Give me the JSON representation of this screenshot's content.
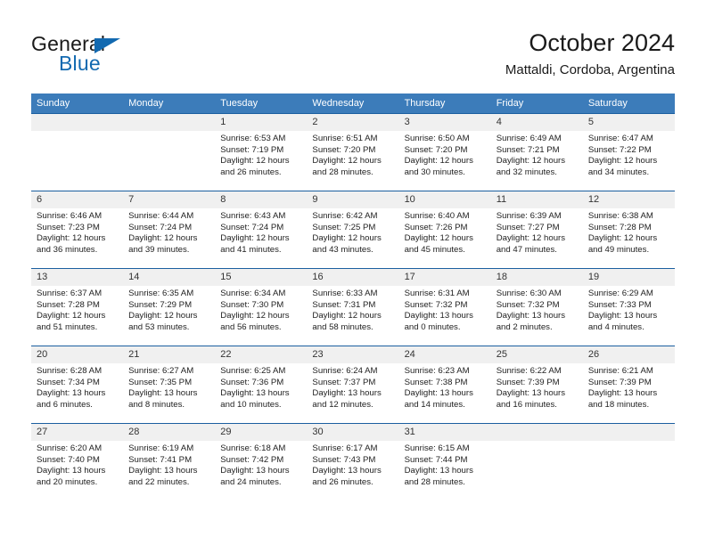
{
  "brand": {
    "name_dark": "General",
    "name_blue": "Blue",
    "accent_color": "#1269b0"
  },
  "header": {
    "title": "October 2024",
    "subtitle": "Mattaldi, Cordoba, Argentina"
  },
  "calendar": {
    "header_bg": "#3c7cba",
    "row_rule_color": "#1b5fa0",
    "daynum_bg": "#f0f0f0",
    "weekday_labels": [
      "Sunday",
      "Monday",
      "Tuesday",
      "Wednesday",
      "Thursday",
      "Friday",
      "Saturday"
    ],
    "weeks": [
      [
        {
          "day": "",
          "sunrise": "",
          "sunset": "",
          "daylight_line1": "",
          "daylight_line2": ""
        },
        {
          "day": "",
          "sunrise": "",
          "sunset": "",
          "daylight_line1": "",
          "daylight_line2": ""
        },
        {
          "day": "1",
          "sunrise": "Sunrise: 6:53 AM",
          "sunset": "Sunset: 7:19 PM",
          "daylight_line1": "Daylight: 12 hours",
          "daylight_line2": "and 26 minutes."
        },
        {
          "day": "2",
          "sunrise": "Sunrise: 6:51 AM",
          "sunset": "Sunset: 7:20 PM",
          "daylight_line1": "Daylight: 12 hours",
          "daylight_line2": "and 28 minutes."
        },
        {
          "day": "3",
          "sunrise": "Sunrise: 6:50 AM",
          "sunset": "Sunset: 7:20 PM",
          "daylight_line1": "Daylight: 12 hours",
          "daylight_line2": "and 30 minutes."
        },
        {
          "day": "4",
          "sunrise": "Sunrise: 6:49 AM",
          "sunset": "Sunset: 7:21 PM",
          "daylight_line1": "Daylight: 12 hours",
          "daylight_line2": "and 32 minutes."
        },
        {
          "day": "5",
          "sunrise": "Sunrise: 6:47 AM",
          "sunset": "Sunset: 7:22 PM",
          "daylight_line1": "Daylight: 12 hours",
          "daylight_line2": "and 34 minutes."
        }
      ],
      [
        {
          "day": "6",
          "sunrise": "Sunrise: 6:46 AM",
          "sunset": "Sunset: 7:23 PM",
          "daylight_line1": "Daylight: 12 hours",
          "daylight_line2": "and 36 minutes."
        },
        {
          "day": "7",
          "sunrise": "Sunrise: 6:44 AM",
          "sunset": "Sunset: 7:24 PM",
          "daylight_line1": "Daylight: 12 hours",
          "daylight_line2": "and 39 minutes."
        },
        {
          "day": "8",
          "sunrise": "Sunrise: 6:43 AM",
          "sunset": "Sunset: 7:24 PM",
          "daylight_line1": "Daylight: 12 hours",
          "daylight_line2": "and 41 minutes."
        },
        {
          "day": "9",
          "sunrise": "Sunrise: 6:42 AM",
          "sunset": "Sunset: 7:25 PM",
          "daylight_line1": "Daylight: 12 hours",
          "daylight_line2": "and 43 minutes."
        },
        {
          "day": "10",
          "sunrise": "Sunrise: 6:40 AM",
          "sunset": "Sunset: 7:26 PM",
          "daylight_line1": "Daylight: 12 hours",
          "daylight_line2": "and 45 minutes."
        },
        {
          "day": "11",
          "sunrise": "Sunrise: 6:39 AM",
          "sunset": "Sunset: 7:27 PM",
          "daylight_line1": "Daylight: 12 hours",
          "daylight_line2": "and 47 minutes."
        },
        {
          "day": "12",
          "sunrise": "Sunrise: 6:38 AM",
          "sunset": "Sunset: 7:28 PM",
          "daylight_line1": "Daylight: 12 hours",
          "daylight_line2": "and 49 minutes."
        }
      ],
      [
        {
          "day": "13",
          "sunrise": "Sunrise: 6:37 AM",
          "sunset": "Sunset: 7:28 PM",
          "daylight_line1": "Daylight: 12 hours",
          "daylight_line2": "and 51 minutes."
        },
        {
          "day": "14",
          "sunrise": "Sunrise: 6:35 AM",
          "sunset": "Sunset: 7:29 PM",
          "daylight_line1": "Daylight: 12 hours",
          "daylight_line2": "and 53 minutes."
        },
        {
          "day": "15",
          "sunrise": "Sunrise: 6:34 AM",
          "sunset": "Sunset: 7:30 PM",
          "daylight_line1": "Daylight: 12 hours",
          "daylight_line2": "and 56 minutes."
        },
        {
          "day": "16",
          "sunrise": "Sunrise: 6:33 AM",
          "sunset": "Sunset: 7:31 PM",
          "daylight_line1": "Daylight: 12 hours",
          "daylight_line2": "and 58 minutes."
        },
        {
          "day": "17",
          "sunrise": "Sunrise: 6:31 AM",
          "sunset": "Sunset: 7:32 PM",
          "daylight_line1": "Daylight: 13 hours",
          "daylight_line2": "and 0 minutes."
        },
        {
          "day": "18",
          "sunrise": "Sunrise: 6:30 AM",
          "sunset": "Sunset: 7:32 PM",
          "daylight_line1": "Daylight: 13 hours",
          "daylight_line2": "and 2 minutes."
        },
        {
          "day": "19",
          "sunrise": "Sunrise: 6:29 AM",
          "sunset": "Sunset: 7:33 PM",
          "daylight_line1": "Daylight: 13 hours",
          "daylight_line2": "and 4 minutes."
        }
      ],
      [
        {
          "day": "20",
          "sunrise": "Sunrise: 6:28 AM",
          "sunset": "Sunset: 7:34 PM",
          "daylight_line1": "Daylight: 13 hours",
          "daylight_line2": "and 6 minutes."
        },
        {
          "day": "21",
          "sunrise": "Sunrise: 6:27 AM",
          "sunset": "Sunset: 7:35 PM",
          "daylight_line1": "Daylight: 13 hours",
          "daylight_line2": "and 8 minutes."
        },
        {
          "day": "22",
          "sunrise": "Sunrise: 6:25 AM",
          "sunset": "Sunset: 7:36 PM",
          "daylight_line1": "Daylight: 13 hours",
          "daylight_line2": "and 10 minutes."
        },
        {
          "day": "23",
          "sunrise": "Sunrise: 6:24 AM",
          "sunset": "Sunset: 7:37 PM",
          "daylight_line1": "Daylight: 13 hours",
          "daylight_line2": "and 12 minutes."
        },
        {
          "day": "24",
          "sunrise": "Sunrise: 6:23 AM",
          "sunset": "Sunset: 7:38 PM",
          "daylight_line1": "Daylight: 13 hours",
          "daylight_line2": "and 14 minutes."
        },
        {
          "day": "25",
          "sunrise": "Sunrise: 6:22 AM",
          "sunset": "Sunset: 7:39 PM",
          "daylight_line1": "Daylight: 13 hours",
          "daylight_line2": "and 16 minutes."
        },
        {
          "day": "26",
          "sunrise": "Sunrise: 6:21 AM",
          "sunset": "Sunset: 7:39 PM",
          "daylight_line1": "Daylight: 13 hours",
          "daylight_line2": "and 18 minutes."
        }
      ],
      [
        {
          "day": "27",
          "sunrise": "Sunrise: 6:20 AM",
          "sunset": "Sunset: 7:40 PM",
          "daylight_line1": "Daylight: 13 hours",
          "daylight_line2": "and 20 minutes."
        },
        {
          "day": "28",
          "sunrise": "Sunrise: 6:19 AM",
          "sunset": "Sunset: 7:41 PM",
          "daylight_line1": "Daylight: 13 hours",
          "daylight_line2": "and 22 minutes."
        },
        {
          "day": "29",
          "sunrise": "Sunrise: 6:18 AM",
          "sunset": "Sunset: 7:42 PM",
          "daylight_line1": "Daylight: 13 hours",
          "daylight_line2": "and 24 minutes."
        },
        {
          "day": "30",
          "sunrise": "Sunrise: 6:17 AM",
          "sunset": "Sunset: 7:43 PM",
          "daylight_line1": "Daylight: 13 hours",
          "daylight_line2": "and 26 minutes."
        },
        {
          "day": "31",
          "sunrise": "Sunrise: 6:15 AM",
          "sunset": "Sunset: 7:44 PM",
          "daylight_line1": "Daylight: 13 hours",
          "daylight_line2": "and 28 minutes."
        },
        {
          "day": "",
          "sunrise": "",
          "sunset": "",
          "daylight_line1": "",
          "daylight_line2": ""
        },
        {
          "day": "",
          "sunrise": "",
          "sunset": "",
          "daylight_line1": "",
          "daylight_line2": ""
        }
      ]
    ]
  }
}
